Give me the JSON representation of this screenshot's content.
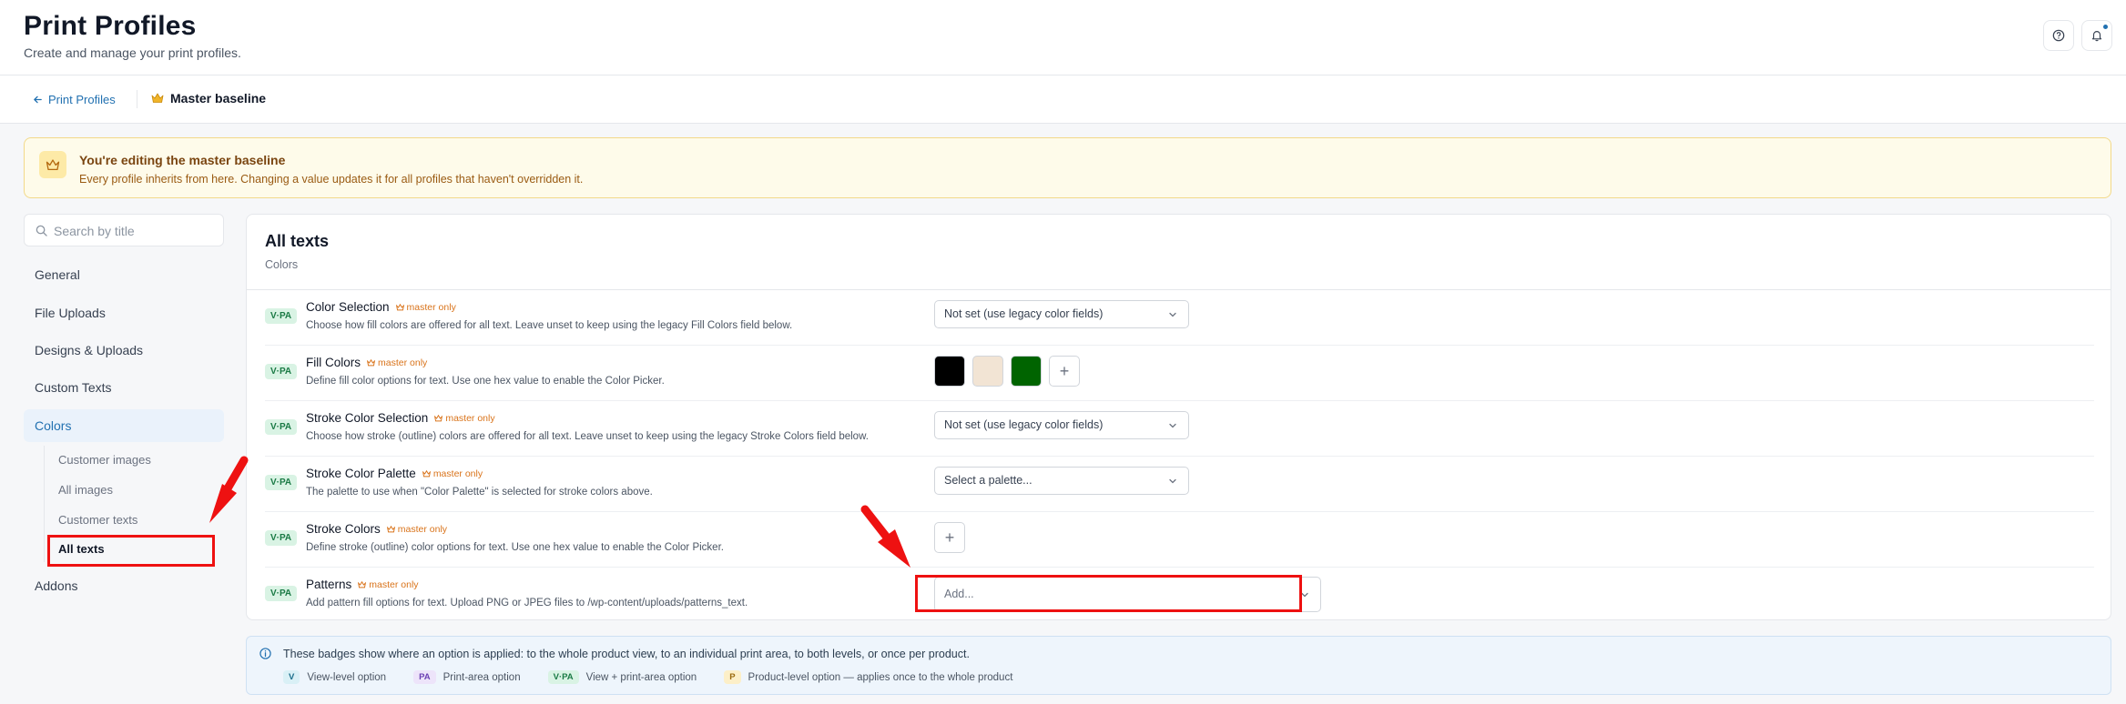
{
  "header": {
    "title": "Print Profiles",
    "subtitle": "Create and manage your print profiles."
  },
  "breadcrumb": {
    "back_label": "Print Profiles",
    "current": "Master baseline"
  },
  "notice": {
    "title": "You're editing the master baseline",
    "text": "Every profile inherits from here. Changing a value updates it for all profiles that haven't overridden it."
  },
  "search": {
    "placeholder": "Search by title"
  },
  "nav": {
    "items": [
      "General",
      "File Uploads",
      "Designs & Uploads",
      "Custom Texts",
      "Colors",
      "Addons"
    ],
    "active": "Colors",
    "sub_items": [
      "Customer images",
      "All images",
      "Customer texts",
      "All texts"
    ],
    "active_sub": "All texts"
  },
  "panel": {
    "title": "All texts",
    "subtitle": "Colors",
    "badge": "V·PA",
    "master_only_label": "master only",
    "rows": [
      {
        "label": "Color Selection",
        "desc": "Choose how fill colors are offered for all text. Leave unset to keep using the legacy Fill Colors field below.",
        "control": "Not set (use legacy color fields)"
      },
      {
        "label": "Fill Colors",
        "desc": "Define fill color options for text. Use one hex value to enable the Color Picker."
      },
      {
        "label": "Stroke Color Selection",
        "desc": "Choose how stroke (outline) colors are offered for all text. Leave unset to keep using the legacy Stroke Colors field below.",
        "control": "Not set (use legacy color fields)"
      },
      {
        "label": "Stroke Color Palette",
        "desc": "The palette to use when \"Color Palette\" is selected for stroke colors above.",
        "control": "Select a palette..."
      },
      {
        "label": "Stroke Colors",
        "desc": "Define stroke (outline) color options for text. Use one hex value to enable the Color Picker."
      },
      {
        "label": "Patterns",
        "desc": "Add pattern fill options for text. Upload PNG or JPEG files to /wp-content/uploads/patterns_text.",
        "control": "Add..."
      }
    ],
    "fill_colors": [
      "#000000",
      "#f2e4d4",
      "#006400"
    ],
    "add_symbol": "+"
  },
  "legend": {
    "text": "These badges show where an option is applied: to the whole product view, to an individual print area, to both levels, or once per product.",
    "items": [
      {
        "badge": "V",
        "label": "View-level option"
      },
      {
        "badge": "PA",
        "label": "Print-area option"
      },
      {
        "badge": "V·PA",
        "label": "View + print-area option"
      },
      {
        "badge": "P",
        "label": "Product-level option — applies once to the whole product"
      }
    ]
  },
  "colors": {
    "accent": "#2271b1",
    "highlight": "#ee1111"
  }
}
